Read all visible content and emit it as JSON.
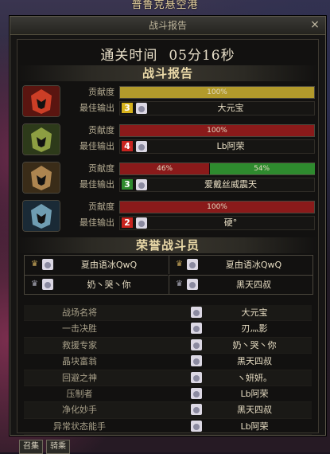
{
  "background": {
    "banner": "普鲁克悬空港"
  },
  "window": {
    "title": "战斗报告",
    "close_glyph": "×"
  },
  "clear_time": {
    "label": "通关时间",
    "value": "05分16秒"
  },
  "section_report": "战斗报告",
  "section_honor": "荣誉战斗员",
  "players": [
    {
      "contrib_label": "贡献度",
      "contrib_text": [
        "100%"
      ],
      "contrib_values": [
        100
      ],
      "bar_colors": [
        "#b29a2b"
      ],
      "best_label": "最佳输出",
      "rank": "3",
      "rank_color": "#d6b21c",
      "name": "大元宝",
      "emblem": "red-helmet-icon"
    },
    {
      "contrib_label": "贡献度",
      "contrib_text": [
        "100%"
      ],
      "contrib_values": [
        100
      ],
      "bar_colors": [
        "#8a1a1a"
      ],
      "best_label": "最佳输出",
      "rank": "4",
      "rank_color": "#c8241f",
      "name": "Lb阿荣",
      "emblem": "green-helmet-icon"
    },
    {
      "contrib_label": "贡献度",
      "contrib_text": [
        "46%",
        "54%"
      ],
      "contrib_values": [
        46,
        54
      ],
      "bar_colors": [
        "#8a1a1a",
        "#2e8a2e"
      ],
      "best_label": "最佳输出",
      "rank": "3",
      "rank_color": "#2e8a2e",
      "name": "爱戴丝威震天",
      "emblem": "bronze-helmet-icon"
    },
    {
      "contrib_label": "贡献度",
      "contrib_text": [
        "100%"
      ],
      "contrib_values": [
        100
      ],
      "bar_colors": [
        "#8a1a1a"
      ],
      "best_label": "最佳输出",
      "rank": "2",
      "rank_color": "#c8241f",
      "name": "硬°",
      "emblem": "blue-helmet-icon"
    }
  ],
  "honor": [
    {
      "name": "夏由语冰QwQ",
      "crown": "gold-crown-icon"
    },
    {
      "name": "夏由语冰QwQ",
      "crown": "gold-crown-icon"
    },
    {
      "name": "奶丶哭丶你",
      "crown": "silver-crown-icon"
    },
    {
      "name": "黑天四叔",
      "crown": "silver-crown-icon"
    }
  ],
  "awards": [
    {
      "title": "战场名将",
      "name": "大元宝"
    },
    {
      "title": "一击决胜",
      "name": "刃灬影"
    },
    {
      "title": "救援专家",
      "name": "奶丶哭丶你"
    },
    {
      "title": "晶块富翁",
      "name": "黑天四叔"
    },
    {
      "title": "回避之神",
      "name": "ヽ妍妍。"
    },
    {
      "title": "压制者",
      "name": "Lb阿荣"
    },
    {
      "title": "净化妙手",
      "name": "黑天四叔"
    },
    {
      "title": "异常状态能手",
      "name": "Lb阿荣"
    }
  ],
  "bottom_buttons": [
    "召集",
    "骑乘"
  ]
}
